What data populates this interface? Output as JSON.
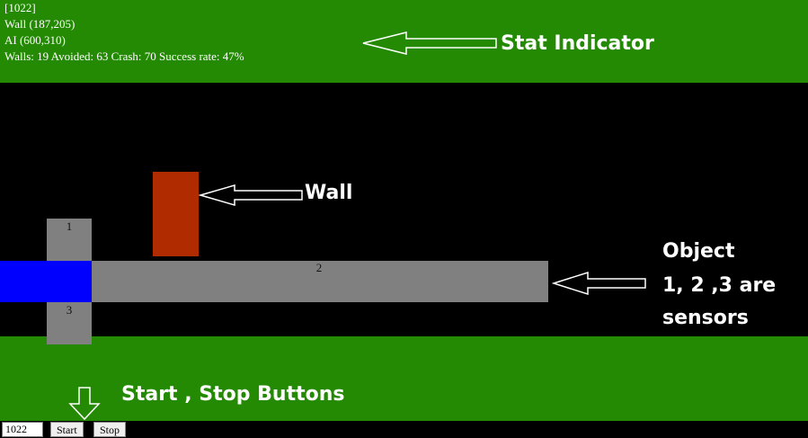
{
  "colors": {
    "grass": "#248a04",
    "road": "#000000",
    "wall": "#b02c00",
    "agent": "#0000ff",
    "sensor": "#808080",
    "text": "#ffffff"
  },
  "stats": {
    "frame": "[1022]",
    "wall": "Wall (187,205)",
    "ai": "AI (600,310)",
    "summary": "Walls: 19 Avoided: 63 Crash: 70 Success rate: 47%"
  },
  "callouts": {
    "stat": "Stat Indicator",
    "wall": "Wall",
    "object_line1": "Object",
    "object_line2": "1, 2 ,3 are",
    "object_line3": "sensors",
    "buttons": "Start , Stop Buttons"
  },
  "sensors": {
    "s1": "1",
    "s2": "2",
    "s3": "3"
  },
  "controls": {
    "input_value": "1022",
    "start_label": "Start",
    "stop_label": "Stop"
  },
  "icons": [
    "arrow-left-icon",
    "arrow-down-icon"
  ]
}
